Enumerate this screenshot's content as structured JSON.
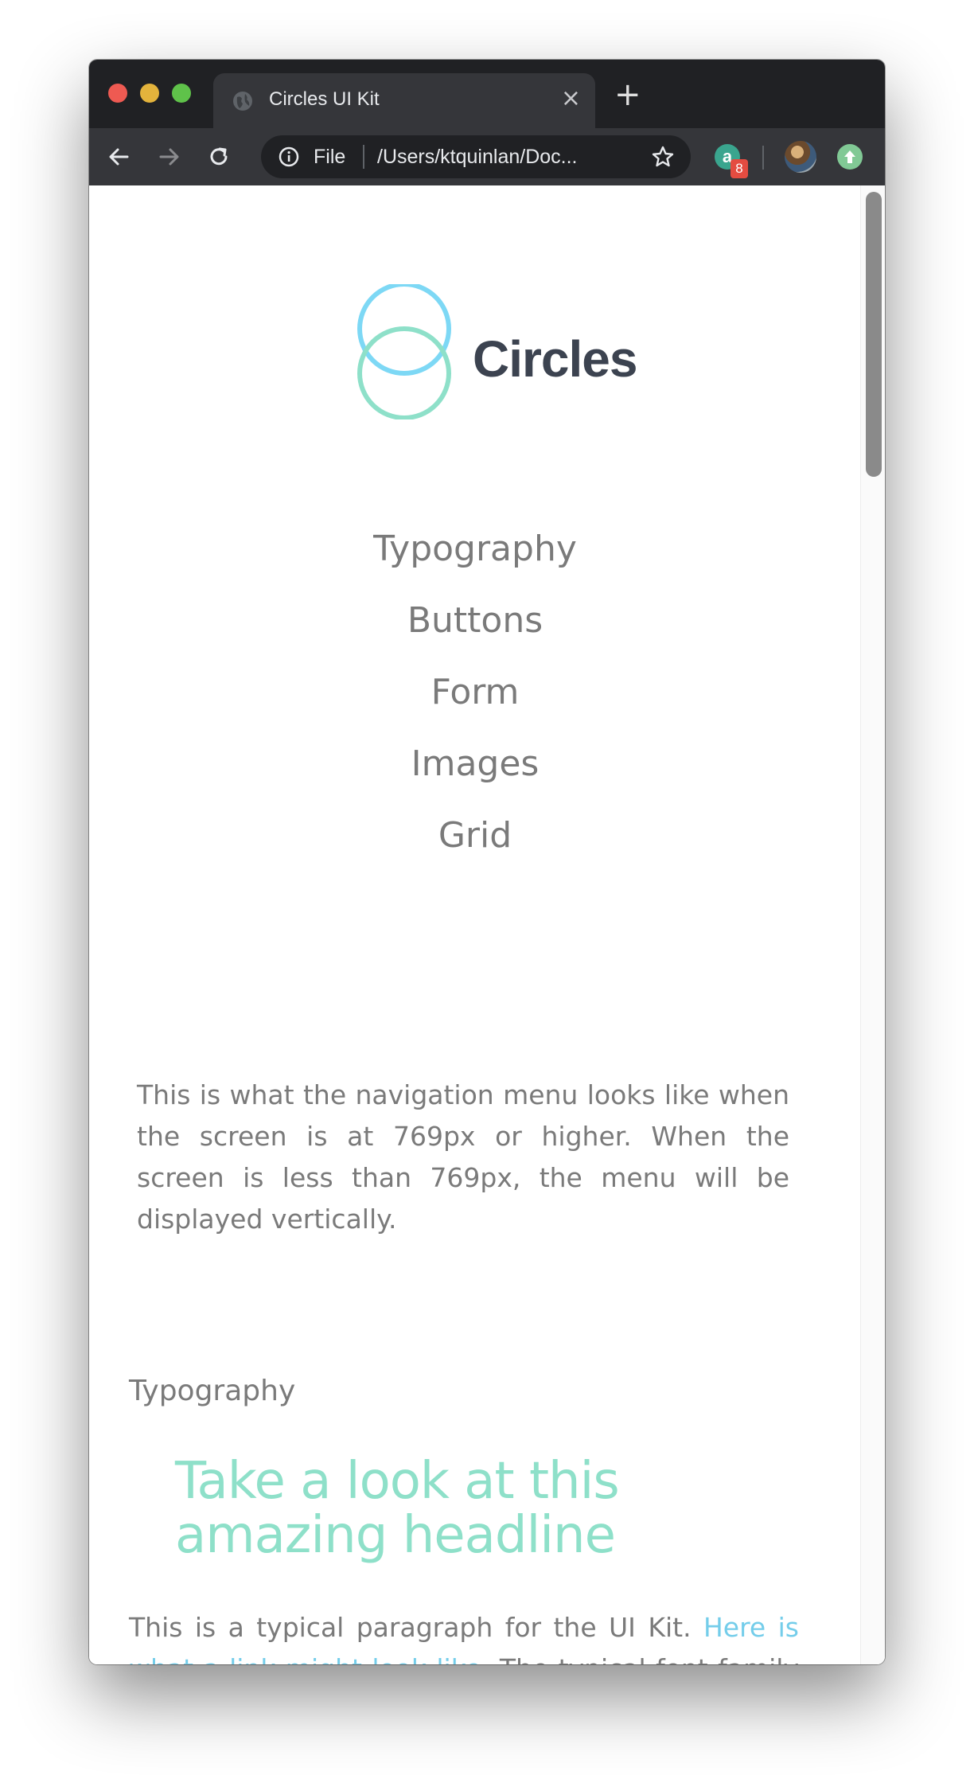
{
  "browser": {
    "tab_title": "Circles UI Kit",
    "tab_close": "×",
    "new_tab": "+",
    "omnibox": {
      "scheme_label": "File",
      "url": "/Users/ktquinlan/Doc..."
    },
    "extension_badge": "8",
    "icons": [
      "back-icon",
      "forward-icon",
      "reload-icon",
      "info-icon",
      "star-icon",
      "extension-icon",
      "profile-avatar",
      "update-icon",
      "globe-icon"
    ],
    "colors": {
      "frame": "#202124",
      "toolbar": "#35363a",
      "badge": "#e44c41"
    }
  },
  "page": {
    "logo_text": "Circles",
    "logo_colors": {
      "circle_top": "#7dd8f5",
      "circle_bottom": "#8ee0c9",
      "text": "#3c4350"
    },
    "nav": [
      "Typography",
      "Buttons",
      "Form",
      "Images",
      "Grid"
    ],
    "intro": "This is what the navigation menu looks like when the screen is at 769px or higher. When the screen is less than 769px, the menu will be displayed vertically.",
    "section_title": "Typography",
    "headline": "Take a look at this amazing headline",
    "paragraph": {
      "before_link": "This is a typical paragraph for the UI Kit. ",
      "link": "Here is what a link might look like",
      "after_link": ". The typical font family for this kit is Helvetica Neue. This kit is intended for"
    },
    "colors": {
      "headline": "#8ee0c9",
      "link": "#74cdea",
      "text": "#7a7a7a"
    }
  }
}
